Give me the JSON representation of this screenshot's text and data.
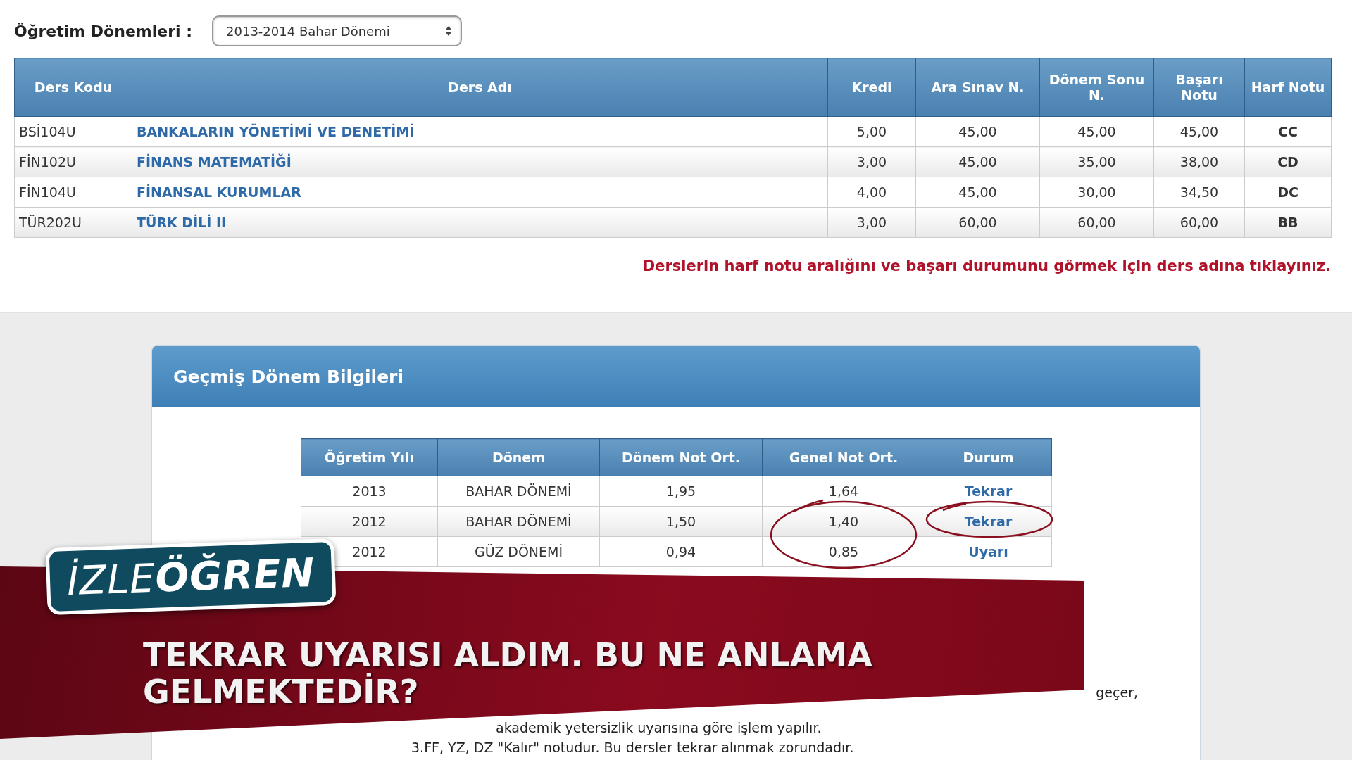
{
  "term_selector": {
    "label": "Öğretim Dönemleri :",
    "value": "2013-2014 Bahar Dönemi"
  },
  "courses": {
    "columns": [
      "Ders Kodu",
      "Ders Adı",
      "Kredi",
      "Ara Sınav N.",
      "Dönem Sonu N.",
      "Başarı Notu",
      "Harf Notu"
    ],
    "rows": [
      {
        "code": "BSİ104U",
        "name": "BANKALARIN YÖNETİMİ VE DENETİMİ",
        "credit": "5,00",
        "midterm": "45,00",
        "final": "45,00",
        "score": "45,00",
        "letter": "CC"
      },
      {
        "code": "FİN102U",
        "name": "FİNANS MATEMATİĞİ",
        "credit": "3,00",
        "midterm": "45,00",
        "final": "35,00",
        "score": "38,00",
        "letter": "CD"
      },
      {
        "code": "FİN104U",
        "name": "FİNANSAL KURUMLAR",
        "credit": "4,00",
        "midterm": "45,00",
        "final": "30,00",
        "score": "34,50",
        "letter": "DC"
      },
      {
        "code": "TÜR202U",
        "name": "TÜRK DİLİ II",
        "credit": "3,00",
        "midterm": "60,00",
        "final": "60,00",
        "score": "60,00",
        "letter": "BB"
      }
    ]
  },
  "note": "Derslerin harf notu aralığını ve başarı durumunu görmek için ders adına tıklayınız.",
  "past_terms": {
    "title": "Geçmiş Dönem Bilgileri",
    "columns": [
      "Öğretim Yılı",
      "Dönem",
      "Dönem Not Ort.",
      "Genel Not Ort.",
      "Durum"
    ],
    "rows": [
      {
        "year": "2013",
        "term": "BAHAR DÖNEMİ",
        "term_avg": "1,95",
        "overall_avg": "1,64",
        "status": "Tekrar"
      },
      {
        "year": "2012",
        "term": "BAHAR DÖNEMİ",
        "term_avg": "1,50",
        "overall_avg": "1,40",
        "status": "Tekrar"
      },
      {
        "year": "2012",
        "term": "GÜZ DÖNEMİ",
        "term_avg": "0,94",
        "overall_avg": "0,85",
        "status": "Uyarı"
      }
    ],
    "notes": [
      "geçer,",
      "akademik yetersizlik uyarısına göre işlem yapılır.",
      "3.FF, YZ, DZ \"Kalır\" notudur. Bu dersler tekrar alınmak zorundadır."
    ]
  },
  "banner": {
    "brand_light": "İZLE",
    "brand_bold": "ÖĞREN",
    "title": "TEKRAR UYARISI ALDIM. BU NE ANLAMA GELMEKTEDİR?"
  }
}
